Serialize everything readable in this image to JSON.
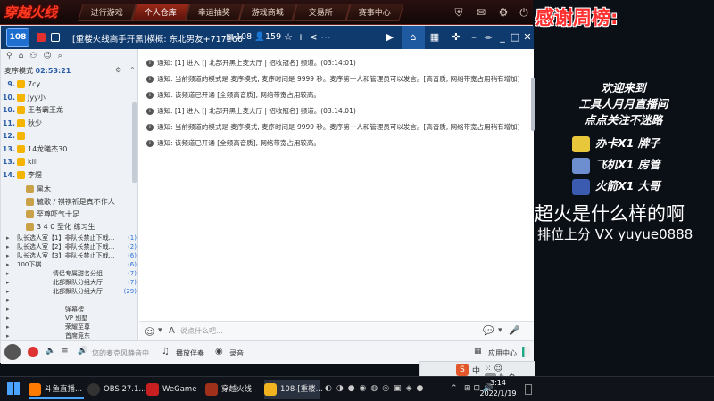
{
  "game": {
    "logo": "穿越火线",
    "tabs": [
      "进行游戏",
      "个人仓库",
      "幸运抽奖",
      "游戏商城",
      "交易所",
      "赛事中心"
    ],
    "active_tab_index": 1
  },
  "overlay": {
    "title": "感谢周榜:",
    "welcome": "欢迎来到",
    "room": "工具人月月直播间",
    "follow": "点点关注不迷路",
    "gifts": [
      {
        "text": "办卡X1 牌子",
        "color": "#e8c73a"
      },
      {
        "text": "飞机X1 房管",
        "color": "#6d8fcf"
      },
      {
        "text": "火箭X1 大哥",
        "color": "#3a5bb0"
      }
    ],
    "big_line": "超火是什么样的啊",
    "contact": "排位上分 VX yuyue0888"
  },
  "client": {
    "level": "108",
    "channel_title": "[重楼火线高手开黑]横概: 东北男友+717266",
    "count_a": "108",
    "count_b": "159",
    "queue_label": "麦序模式",
    "queue_time": "02:53:21",
    "list": [
      {
        "n": "9.",
        "name": "7cy"
      },
      {
        "n": "10.",
        "name": "Jyy小"
      },
      {
        "n": "10.",
        "name": "王者霸王龙"
      },
      {
        "n": "11.",
        "name": "秋少"
      },
      {
        "n": "12.",
        "name": ""
      },
      {
        "n": "13.",
        "name": "14龙曦杰30"
      },
      {
        "n": "13.",
        "name": "kill"
      },
      {
        "n": "14.",
        "name": "李煜"
      }
    ],
    "members": [
      "黑木",
      "毓歌 / 祺祺祈是真不作人",
      "至尊吓气十足",
      "3 4 0 圣化 练习生"
    ],
    "channels": [
      {
        "name": "队长选人室【1】非队长禁止下戟…",
        "count": "(1)"
      },
      {
        "name": "队长选人室【2】非队长禁止下戟…",
        "count": "(2)"
      },
      {
        "name": "队长选人室【3】非队长禁止下戟…",
        "count": "(6)"
      },
      {
        "name": "100下棋",
        "count": "(6)"
      },
      {
        "name": "情侣专属甜名分组",
        "count": "(7)"
      },
      {
        "name": "北部飘队分组大厅",
        "count": "(7)"
      },
      {
        "name": "北部飘队分组大厅",
        "count": "(29)"
      },
      {
        "name": "",
        "count": ""
      },
      {
        "name": "弹幕榜",
        "count": ""
      },
      {
        "name": "VP 别墅",
        "count": ""
      },
      {
        "name": "荣耀至尊",
        "count": ""
      },
      {
        "name": "首席竞东",
        "count": ""
      }
    ],
    "messages": [
      "通知: [1] 进入 [|             北部开黑上麦大厅          | 招收冠名] 频道。(03:14:01)",
      "通知: 当前频道的模式是 麦序模式, 麦序时间是 9999 秒。麦序第一人和管理员可以发言。[高音质, 网络带宽占用稍有增加]",
      "通知: 该频道已开通 [全频高音质], 网络带宽占用较高。",
      "通知: [1] 进入 [|             北部开黑上麦大厅          | 招收冠名] 频道。(03:14:01)",
      "通知: 当前频道的模式是 麦序模式, 麦序时间是 9999 秒。麦序第一人和管理员可以发言。[高音质, 网络带宽占用稍有增加]",
      "通知: 该频道已开通 [全频高音质], 网络带宽占用较高。"
    ],
    "input_placeholder": "说点什么吧...",
    "bottom": {
      "status": "您的麦克风静音中",
      "play": "播放伴奏",
      "record": "录音",
      "hotkey": "应用中心"
    }
  },
  "taskbar": {
    "items": [
      {
        "label": "斗鱼直播...",
        "color": "#ff7a00"
      },
      {
        "label": "OBS 27.1...",
        "color": "#333333"
      },
      {
        "label": "WeGame",
        "color": "#c82020"
      },
      {
        "label": "穿越火线",
        "color": "#a0301a"
      },
      {
        "label": "108-[重楼...",
        "color": "#f2b320"
      }
    ],
    "time": "3:14",
    "date": "2022/1/19",
    "lang": "中"
  }
}
